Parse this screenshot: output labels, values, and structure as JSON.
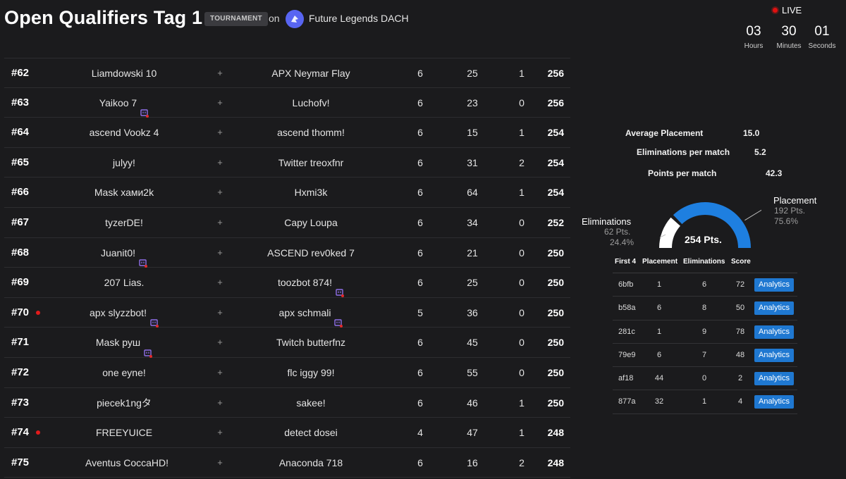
{
  "header": {
    "title": "Open Qualifiers Tag 1",
    "badge": "TOURNAMENT",
    "on": "on",
    "organizer": "Future Legends DACH"
  },
  "live": {
    "label": "LIVE",
    "hours": "03",
    "hours_label": "Hours",
    "minutes": "30",
    "minutes_label": "Minutes",
    "seconds": "01",
    "seconds_label": "Seconds"
  },
  "leaderboard": [
    {
      "rank": "#62",
      "p1": "Liamdowski 10",
      "p1_twitch": false,
      "p2": "APX Neymar Flay",
      "p2_twitch": false,
      "matches": "6",
      "placement": "25",
      "elims": "1",
      "points": "256",
      "dot": false
    },
    {
      "rank": "#63",
      "p1": "Yaikoo 7",
      "p1_twitch": true,
      "p2": "Luchofv!",
      "p2_twitch": false,
      "matches": "6",
      "placement": "23",
      "elims": "0",
      "points": "256",
      "dot": false
    },
    {
      "rank": "#64",
      "p1": "ascend Vookz 4",
      "p1_twitch": false,
      "p2": "ascend thomm!",
      "p2_twitch": false,
      "matches": "6",
      "placement": "15",
      "elims": "1",
      "points": "254",
      "dot": false
    },
    {
      "rank": "#65",
      "p1": "julyy!",
      "p1_twitch": false,
      "p2": "Twitter treoxfnr",
      "p2_twitch": false,
      "matches": "6",
      "placement": "31",
      "elims": "2",
      "points": "254",
      "dot": false
    },
    {
      "rank": "#66",
      "p1": "Mask хами2k",
      "p1_twitch": false,
      "p2": "Hxmi3k",
      "p2_twitch": false,
      "matches": "6",
      "placement": "64",
      "elims": "1",
      "points": "254",
      "dot": false
    },
    {
      "rank": "#67",
      "p1": "tyzerDE!",
      "p1_twitch": false,
      "p2": "Capy Loupa",
      "p2_twitch": false,
      "matches": "6",
      "placement": "34",
      "elims": "0",
      "points": "252",
      "dot": false
    },
    {
      "rank": "#68",
      "p1": "Juanit0!",
      "p1_twitch": true,
      "p2": "ASCEND rev0ked 7",
      "p2_twitch": false,
      "matches": "6",
      "placement": "21",
      "elims": "0",
      "points": "250",
      "dot": false
    },
    {
      "rank": "#69",
      "p1": "207 Lias.",
      "p1_twitch": false,
      "p2": "toozbot 874!",
      "p2_twitch": true,
      "matches": "6",
      "placement": "25",
      "elims": "0",
      "points": "250",
      "dot": false
    },
    {
      "rank": "#70",
      "p1": "apx slyzzbot!",
      "p1_twitch": true,
      "p2": "apx schmali",
      "p2_twitch": true,
      "matches": "5",
      "placement": "36",
      "elims": "0",
      "points": "250",
      "dot": true
    },
    {
      "rank": "#71",
      "p1": "Mask руш",
      "p1_twitch": true,
      "p2": "Twitch butterfnz",
      "p2_twitch": false,
      "matches": "6",
      "placement": "45",
      "elims": "0",
      "points": "250",
      "dot": false
    },
    {
      "rank": "#72",
      "p1": "one eyne!",
      "p1_twitch": false,
      "p2": "flc iggy 99!",
      "p2_twitch": false,
      "matches": "6",
      "placement": "55",
      "elims": "0",
      "points": "250",
      "dot": false
    },
    {
      "rank": "#73",
      "p1": "piecek1ngタ",
      "p1_twitch": false,
      "p2": "sakee!",
      "p2_twitch": false,
      "matches": "6",
      "placement": "46",
      "elims": "1",
      "points": "250",
      "dot": false
    },
    {
      "rank": "#74",
      "p1": "FREEYUICE",
      "p1_twitch": false,
      "p2": "detect dosei",
      "p2_twitch": false,
      "matches": "4",
      "placement": "47",
      "elims": "1",
      "points": "248",
      "dot": true
    },
    {
      "rank": "#75",
      "p1": "Aventus CoccaHD!",
      "p1_twitch": false,
      "p2": "Anaconda 718",
      "p2_twitch": false,
      "matches": "6",
      "placement": "16",
      "elims": "2",
      "points": "248",
      "dot": false
    }
  ],
  "stats": {
    "avg_placement_label": "Average Placement",
    "avg_placement": "15.0",
    "elims_per_match_label": "Eliminations per match",
    "elims_per_match": "5.2",
    "points_per_match_label": "Points per match",
    "points_per_match": "42.3"
  },
  "gauge": {
    "total": "254 Pts.",
    "placement_label": "Placement",
    "placement_pts": "192 Pts.",
    "placement_pct": "75.6%",
    "elims_label": "Eliminations",
    "elims_pts": "62 Pts.",
    "elims_pct": "24.4%",
    "placement_share": 0.756,
    "placement_color": "#1e7fe0",
    "elims_color": "#ffffff"
  },
  "matches": {
    "headers": [
      "First 4",
      "Placement",
      "Eliminations",
      "Score"
    ],
    "button_label": "Analytics",
    "rows": [
      {
        "id": "6bfb",
        "placement": "1",
        "elims": "6",
        "score": "72"
      },
      {
        "id": "b58a",
        "placement": "6",
        "elims": "8",
        "score": "50"
      },
      {
        "id": "281c",
        "placement": "1",
        "elims": "9",
        "score": "78"
      },
      {
        "id": "79e9",
        "placement": "6",
        "elims": "7",
        "score": "48"
      },
      {
        "id": "af18",
        "placement": "44",
        "elims": "0",
        "score": "2"
      },
      {
        "id": "877a",
        "placement": "32",
        "elims": "1",
        "score": "4"
      }
    ]
  },
  "colors": {
    "background": "#1b1b1d",
    "accent": "#1f78d1",
    "live": "#e01010"
  }
}
